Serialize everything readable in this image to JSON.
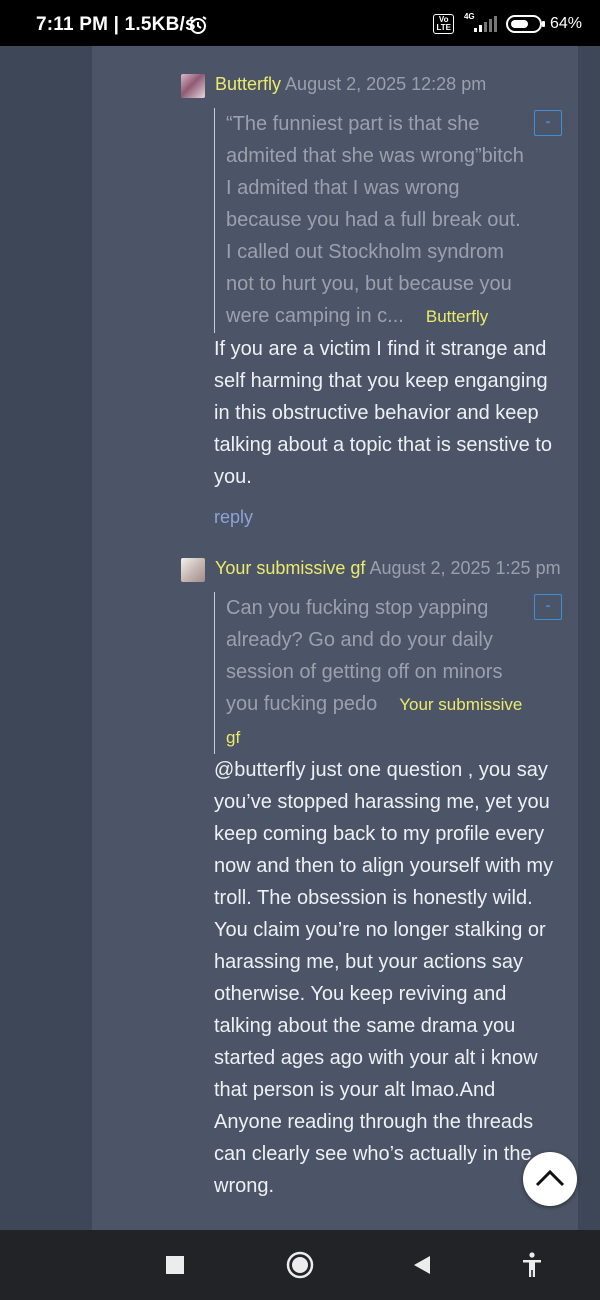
{
  "status_bar": {
    "time_speed": "7:11 PM | 1.5KB/s",
    "volte": "Vo\nLTE",
    "network": "4G",
    "battery_percent": "64%",
    "battery_level": 0.64
  },
  "comments": [
    {
      "author": "Butterfly",
      "date": "August 2, 2025 12:28 pm",
      "quote_text": "“The funniest part is that she admited that she was wrong”bitch I admited that I was wrong because you had a full break out. I called out Stockholm syndrom not to hurt you, but because you were camping in c...",
      "quote_author": "Butterfly",
      "collapse_label": "-",
      "body": "If you are a victim I find it strange and self harming that you keep enganging in this obstructive behavior and keep talking about a topic that is senstive to you.",
      "reply_label": "reply"
    },
    {
      "author": "Your submissive gf",
      "date": "August 2, 2025 1:25 pm",
      "quote_text": "Can you fucking stop yapping already? Go and do your daily session of getting off on minors you fucking pedo",
      "quote_author": "Your submissive gf",
      "collapse_label": "-",
      "body": "@butterfly just one question , you say you’ve stopped harassing me, yet you keep coming back to my profile every now and then to align yourself with my troll. The obsession is honestly wild. You claim you’re no longer stalking or harassing me, but your actions say otherwise. You keep reviving and talking about the same drama you started ages ago with your alt i know that person is your alt lmao.And Anyone reading through the threads can clearly see who’s actually in the wrong."
    }
  ],
  "colors": {
    "author": "#ecea6a",
    "link": "#8ea3d6",
    "panel": "#4c5567",
    "background": "#3e4758"
  },
  "icons": {
    "scroll_top": "chevron-up-icon",
    "nav_recents": "square-icon",
    "nav_home": "circle-icon",
    "nav_back": "triangle-left-icon",
    "nav_accessibility": "accessibility-icon"
  }
}
